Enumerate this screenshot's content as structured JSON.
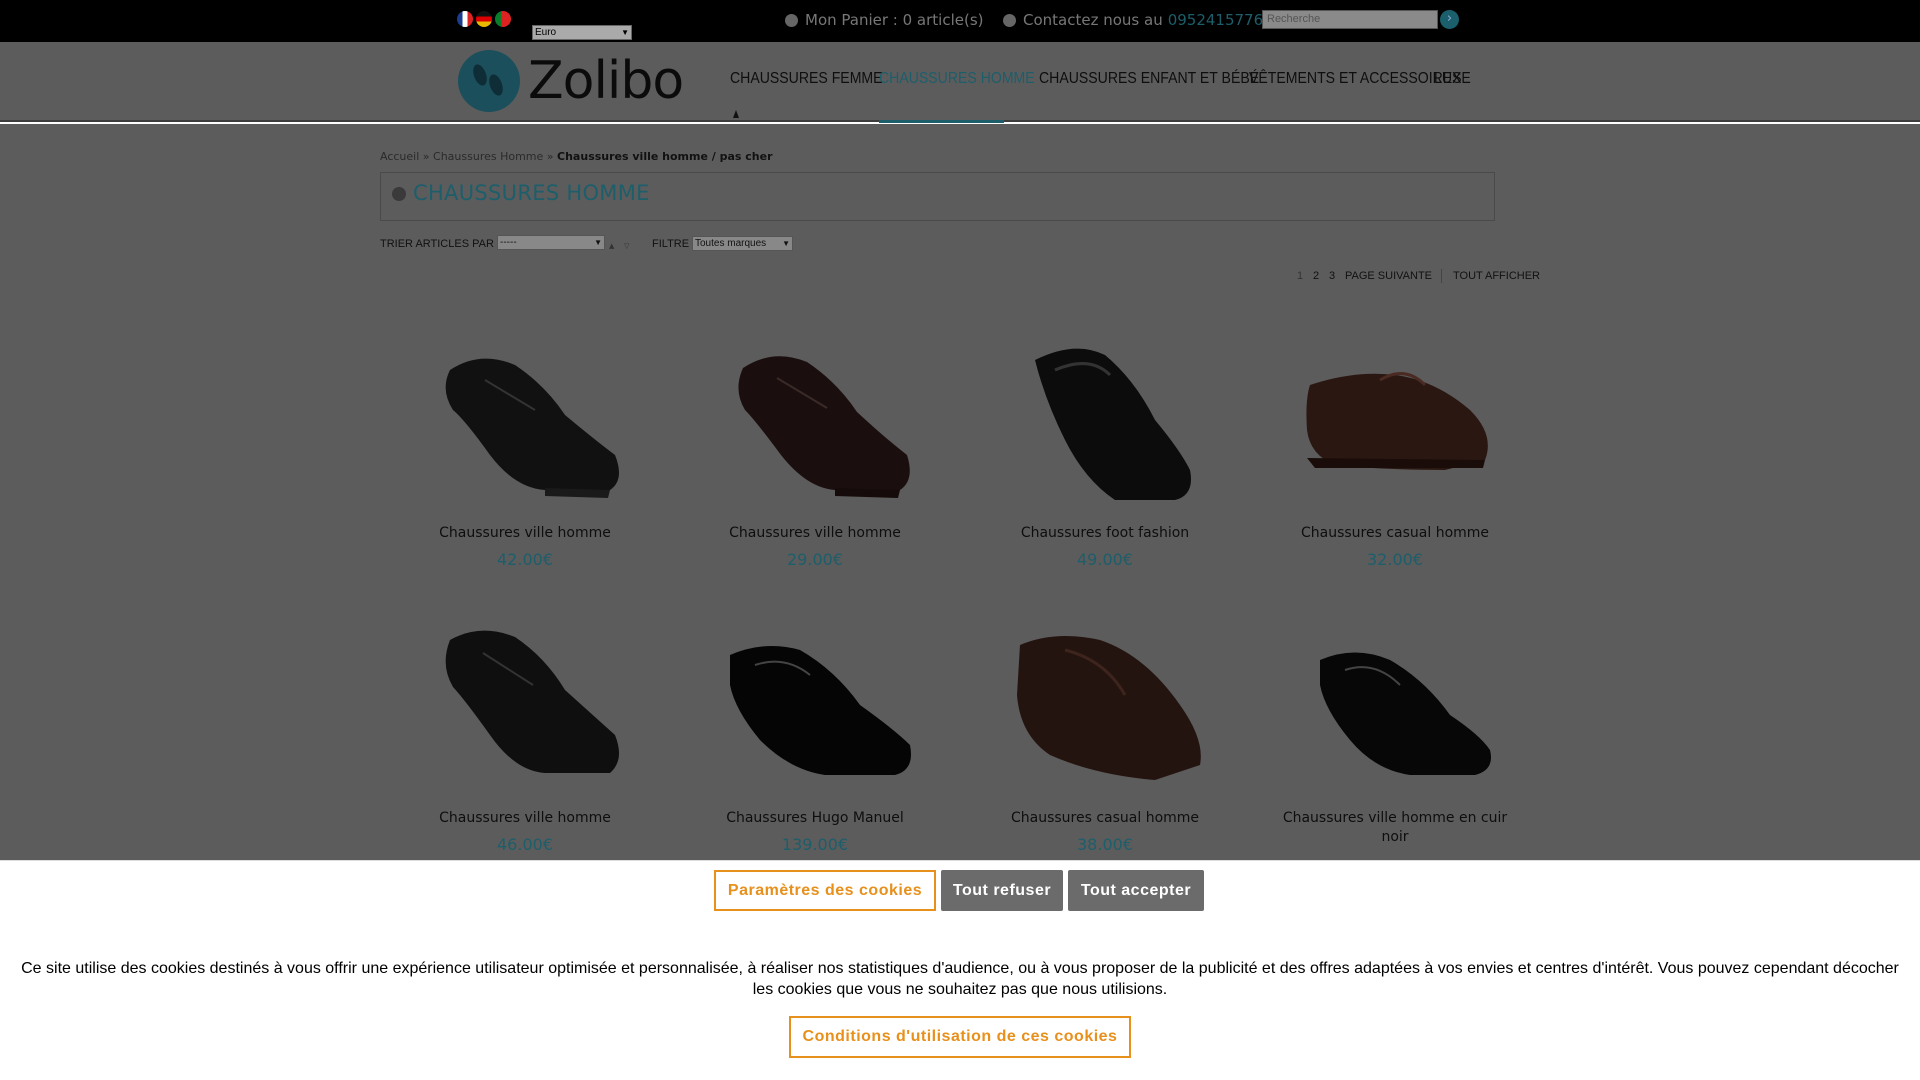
{
  "topbar": {
    "flags": [
      "flag-fr",
      "flag-de",
      "flag-pt"
    ],
    "currency": "Euro",
    "cart_text": "Mon Panier : 0 article(s)",
    "contact_text": "Contactez nous au",
    "phone": "0952415776",
    "search_placeholder": "Recherche",
    "search_icon": "chevron-right-icon"
  },
  "header": {
    "logo_text": "Zolibo",
    "nav": [
      {
        "label": "CHAUSSURES FEMME",
        "active": false
      },
      {
        "label": "CHAUSSURES HOMME",
        "active": true
      },
      {
        "label": "CHAUSSURES ENFANT ET BÉBÉ",
        "active": false
      },
      {
        "label": "VÊTEMENTS ET ACCESSOIRES",
        "active": false
      },
      {
        "label": "LUXE",
        "active": false
      }
    ],
    "accent": "#1d5e6b"
  },
  "breadcrumb": {
    "home": "Accueil",
    "sep": "»",
    "category": "Chaussures Homme",
    "current": "Chaussures ville homme / pas cher"
  },
  "page_title": "CHAUSSURES HOMME",
  "toolbar": {
    "sort_label": "TRIER ARTICLES PAR",
    "sort_value": "-----",
    "filter_label": "FILTRE",
    "filter_value": "Toutes marques"
  },
  "pagination": {
    "pages": [
      "1",
      "2",
      "3"
    ],
    "next": "PAGE SUIVANTE",
    "all": "TOUT AFFICHER"
  },
  "products": [
    {
      "name": "Chaussures ville homme",
      "price": "42.00€"
    },
    {
      "name": "Chaussures ville homme",
      "price": "29.00€"
    },
    {
      "name": "Chaussures foot fashion",
      "price": "49.00€"
    },
    {
      "name": "Chaussures casual homme",
      "price": "32.00€"
    },
    {
      "name": "Chaussures ville homme",
      "price": "46.00€"
    },
    {
      "name": "Chaussures Hugo Manuel",
      "price": "139.00€"
    },
    {
      "name": "Chaussures casual homme",
      "price": "38.00€"
    },
    {
      "name": "Chaussures ville homme en cuir noir",
      "price": ""
    }
  ],
  "cookie": {
    "settings_button": "Paramètres des cookies",
    "refuse_button": "Tout refuser",
    "accept_button": "Tout accepter",
    "text": "Ce site utilise des cookies destinés à vous offrir une expérience utilisateur optimisée et personnalisée, à réaliser nos statistiques d'audience, ou à vous proposer de la publicité et des offres adaptées à vos envies et centres d'intérêt. Vous pouvez cependant décocher les cookies que vous ne souhaitez pas que nous utilisions.",
    "conditions_button": "Conditions d'utilisation de ces cookies",
    "accent": "#e8901c"
  }
}
